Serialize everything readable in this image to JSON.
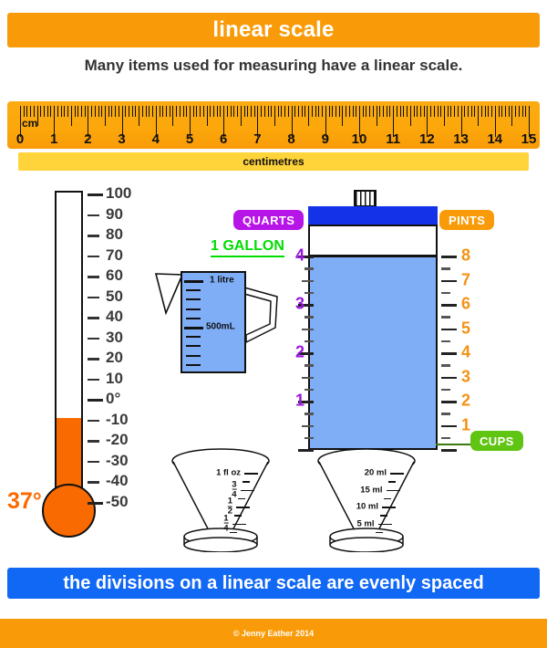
{
  "header": {
    "title": "linear scale"
  },
  "subtitle": "Many items used for measuring have a linear scale.",
  "bottom_banner": "the divisions on a linear scale are evenly spaced",
  "footer": "© Jenny Eather 2014",
  "colors": {
    "header_orange": "#F99B08",
    "banner_blue": "#1168F5",
    "ruler_orange": "#FCA80B",
    "ruler_band_yellow": "#FFD33A",
    "mercury_orange": "#F96A00",
    "water_blue": "#7FAEF7",
    "cap_blue": "#1433E8",
    "quarts_purple": "#B715E8",
    "quarts_number_purple": "#9A16E0",
    "pints_orange": "#F59114",
    "cups_green": "#5FC412",
    "gallon_green": "#00DD00"
  },
  "ruler": {
    "unit_label": "cm",
    "band_label": "centimetres",
    "numbers": [
      "0",
      "1",
      "2",
      "3",
      "4",
      "5",
      "6",
      "7",
      "8",
      "9",
      "10",
      "11",
      "12",
      "13",
      "14",
      "15"
    ],
    "min": 0,
    "max": 15,
    "minor_divisions_per_unit": 10
  },
  "thermometer": {
    "reading": "37°",
    "reading_value": 37,
    "unit": "degrees",
    "scale_labels": [
      "100",
      "90",
      "80",
      "70",
      "60",
      "50",
      "40",
      "30",
      "20",
      "10",
      "0°",
      "-10",
      "-20",
      "-30",
      "-40",
      "-50"
    ],
    "scale_values": [
      100,
      90,
      80,
      70,
      60,
      50,
      40,
      30,
      20,
      10,
      0,
      -10,
      -20,
      -30,
      -40,
      -50
    ],
    "min": -50,
    "max": 100
  },
  "litre_jug": {
    "labels": [
      {
        "text": "1 litre",
        "value": 1000
      },
      {
        "text": "500mL",
        "value": 500
      }
    ],
    "tick_count": 10
  },
  "tank": {
    "quarts": {
      "badge": "QUARTS",
      "numbers": [
        "4",
        "3",
        "2",
        "1"
      ],
      "values": [
        4,
        3,
        2,
        1
      ],
      "subdivisions": 4
    },
    "pints": {
      "badge": "PINTS",
      "numbers": [
        "8",
        "7",
        "6",
        "5",
        "4",
        "3",
        "2",
        "1"
      ],
      "values": [
        8,
        7,
        6,
        5,
        4,
        3,
        2,
        1
      ],
      "subdivisions": 2
    },
    "cups": {
      "badge": "CUPS"
    },
    "gallon_label": "1 GALLON",
    "fill_level_quarts": 4,
    "fill_level_pints": 8
  },
  "cone_left": {
    "labels": [
      {
        "text": "1 fl oz",
        "type": "plain"
      },
      {
        "num": "3",
        "den": "4",
        "type": "fraction"
      },
      {
        "num": "1",
        "den": "2",
        "type": "fraction"
      },
      {
        "num": "1",
        "den": "4",
        "type": "fraction"
      }
    ]
  },
  "cone_right": {
    "labels": [
      "20 ml",
      "15 ml",
      "10 ml",
      "5 ml"
    ]
  }
}
